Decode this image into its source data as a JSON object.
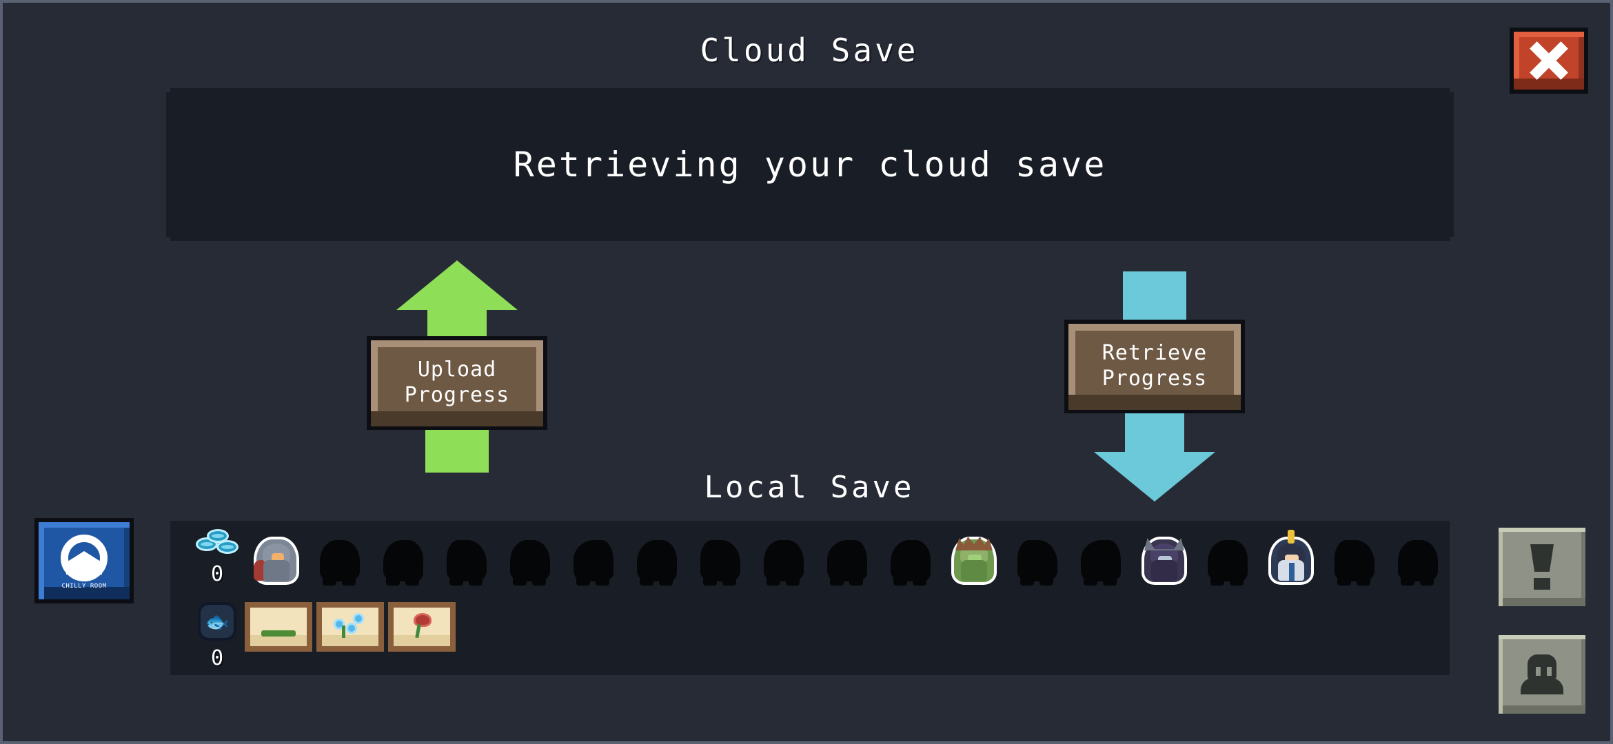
{
  "window": {
    "title": "Cloud Save",
    "close_label": "close-icon"
  },
  "message": {
    "text": "Retrieving your cloud save"
  },
  "actions": {
    "upload": {
      "line1": "Upload",
      "line2": "Progress",
      "arrow": "arrow-up",
      "color": "#8ede58"
    },
    "retrieve": {
      "line1": "Retrieve",
      "line2": "Progress",
      "arrow": "arrow-down",
      "color": "#6cc9da"
    }
  },
  "local_save": {
    "label": "Local Save",
    "currency": {
      "coins": {
        "icon": "coin-stack-icon",
        "count": "0"
      },
      "fish": {
        "icon": "fish-can-icon",
        "count": "0"
      }
    },
    "characters": [
      {
        "name": "knight",
        "locked": false
      },
      {
        "name": "locked-1",
        "locked": true
      },
      {
        "name": "locked-2",
        "locked": true
      },
      {
        "name": "locked-3",
        "locked": true
      },
      {
        "name": "locked-4",
        "locked": true
      },
      {
        "name": "locked-5",
        "locked": true
      },
      {
        "name": "locked-6",
        "locked": true
      },
      {
        "name": "locked-7",
        "locked": true
      },
      {
        "name": "locked-8",
        "locked": true
      },
      {
        "name": "locked-9",
        "locked": true
      },
      {
        "name": "locked-10",
        "locked": true
      },
      {
        "name": "druid",
        "locked": false
      },
      {
        "name": "locked-11",
        "locked": true
      },
      {
        "name": "locked-12",
        "locked": true
      },
      {
        "name": "witch",
        "locked": false
      },
      {
        "name": "locked-13",
        "locked": true
      },
      {
        "name": "priest",
        "locked": false
      },
      {
        "name": "locked-14",
        "locked": true
      },
      {
        "name": "locked-15",
        "locked": true
      },
      {
        "name": "locked-16",
        "locked": true
      }
    ],
    "garden_cards": [
      {
        "name": "seed-card",
        "plant": "seed"
      },
      {
        "name": "blue-flower-card",
        "plant": "blue-flower"
      },
      {
        "name": "red-flower-card",
        "plant": "red-flower"
      }
    ]
  },
  "side_buttons": {
    "logo": {
      "name": "chilly-room-logo-button",
      "text": "CHILLY ROOM"
    },
    "warning": {
      "name": "notice-button",
      "icon": "exclamation-icon"
    },
    "profile": {
      "name": "profile-button",
      "icon": "person-icon"
    }
  },
  "theme": {
    "background": "#272b36",
    "panel": "#191d26",
    "accent_green": "#8ede58",
    "accent_cyan": "#6cc9da",
    "wood": "#6e5944",
    "close_red": "#c1432a"
  }
}
